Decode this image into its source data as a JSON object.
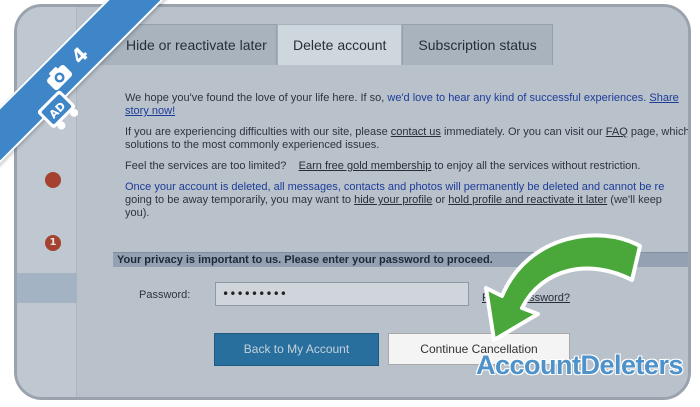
{
  "tabs": {
    "hide_label": "Hide or reactivate later",
    "delete_label": "Delete account",
    "subscription_label": "Subscription status"
  },
  "content": {
    "p1_text": "We hope you've found the love of your life here. If so, ",
    "p1_blue": "we'd love to hear any kind of successful experiences.",
    "p1_link": "Share",
    "p1_link2": "story now!",
    "p2_a": "If you are experiencing difficulties with our site, please ",
    "p2_contact": "contact us",
    "p2_b": " immediately. Or you can visit our ",
    "p2_faq": "FAQ",
    "p2_c": " page, which",
    "p2_d": "solutions to the most commonly experienced issues.",
    "p3_a": "Feel the services are too limited?",
    "p3_link": "Earn free gold membership",
    "p3_b": " to enjoy all the services without restriction.",
    "p4_blue": "Once your account is deleted, all messages, contacts and photos will permanently be deleted and cannot be re",
    "p4_a": "going to be away temporarily, you may want to ",
    "p4_hide": "hide your profile",
    "p4_b": " or ",
    "p4_hold": "hold profile and reactivate it later",
    "p4_c": " (we'll keep",
    "p4_d": "you)."
  },
  "privacy": {
    "notice": "Your privacy is important to us. Please enter your password to proceed."
  },
  "form": {
    "password_label": "Password:",
    "password_value": "•••••••••",
    "forgot_label": "Forgot password?"
  },
  "buttons": {
    "back_label": "Back to My Account",
    "continue_label": "Continue Cancellation"
  },
  "sidebar": {
    "badge_1": "1"
  },
  "overlay": {
    "step_number": "4",
    "watermark": "AccountDeleters",
    "logo_text": "AD"
  },
  "colors": {
    "ribbon": "#3f86c8",
    "arrow": "#4aa83a",
    "button_primary": "#2a79ab",
    "link_blue": "#1c3fa8"
  }
}
